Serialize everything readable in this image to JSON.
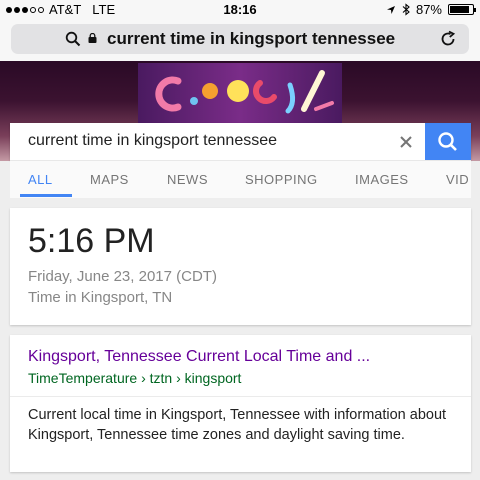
{
  "status_bar": {
    "carrier": "AT&T",
    "network": "LTE",
    "time": "18:16",
    "battery": "87%",
    "battery_level": 0.87
  },
  "address_bar": {
    "query": "current time in kingsport tennessee"
  },
  "search": {
    "query": "current time in kingsport tennessee"
  },
  "tabs": [
    "ALL",
    "MAPS",
    "NEWS",
    "SHOPPING",
    "IMAGES",
    "VID"
  ],
  "time_card": {
    "time": "5:16 PM",
    "date": "Friday, June 23, 2017 (CDT)",
    "location": "Time in Kingsport, TN"
  },
  "result": {
    "title": "Kingsport, Tennessee Current Local Time and ...",
    "url": "TimeTemperature › tztn › kingsport",
    "snippet": "Current local time in Kingsport, Tennessee with information about Kingsport, Tennessee time zones and daylight saving time."
  },
  "colors": {
    "accent": "#4285f4",
    "result_title": "#660099",
    "result_url": "#006621"
  },
  "icons": [
    "search-icon",
    "lock-icon",
    "reload-icon",
    "location-arrow-icon",
    "bluetooth-icon",
    "battery-icon",
    "clear-icon"
  ]
}
